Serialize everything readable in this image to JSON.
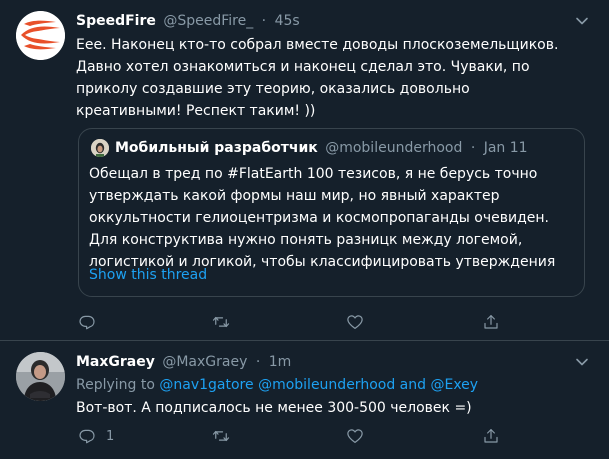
{
  "tweets": [
    {
      "display_name": "SpeedFire",
      "handle": "@SpeedFire_",
      "separator": "·",
      "time": "45s",
      "text": "Еее. Наконец кто-то собрал вместе доводы плоскоземельщиков. Давно хотел ознакомиться и наконец сделал это. Чуваки, по приколу создавшие эту теорию, оказались довольно креативными! Респект таким! ))",
      "avatar_icon": "flame-logo-avatar",
      "colors": {
        "avatar_bg": "#ffffff",
        "flame": "#e8502a"
      },
      "quote": {
        "display_name": "Мобильный разработчик",
        "handle": "@mobileunderhood",
        "separator": "·",
        "time": "Jan 11",
        "text": "Обещал в тред по #FlatEarth 100 тезисов, я не берусь точно утверждать какой формы наш мир, но явный характер оккультности гелиоцентризма и космопропаганды очевиден. Для конструктива нужно понять разницк между логемой, логистикой и логикой, чтобы классифицировать утверждения",
        "show_thread": "Show this thread"
      },
      "actions": {
        "reply_count": "",
        "retweet_count": "",
        "like_count": ""
      }
    },
    {
      "display_name": "MaxGraey",
      "handle": "@MaxGraey",
      "separator": "·",
      "time": "1m",
      "replying_to": {
        "prefix": "Replying to",
        "mention_1": "@nav1gatore",
        "mention_2": "@mobileunderhood",
        "conjunction": "and",
        "mention_3": "@Exey"
      },
      "text": "Вот-вот. А подписалось не менее 300-500 человек =)",
      "actions": {
        "reply_count": "1",
        "retweet_count": "",
        "like_count": ""
      }
    }
  ],
  "colors": {
    "background": "#15202b",
    "border": "#38444d",
    "secondary_text": "#8899a6",
    "accent": "#1da1f2"
  }
}
